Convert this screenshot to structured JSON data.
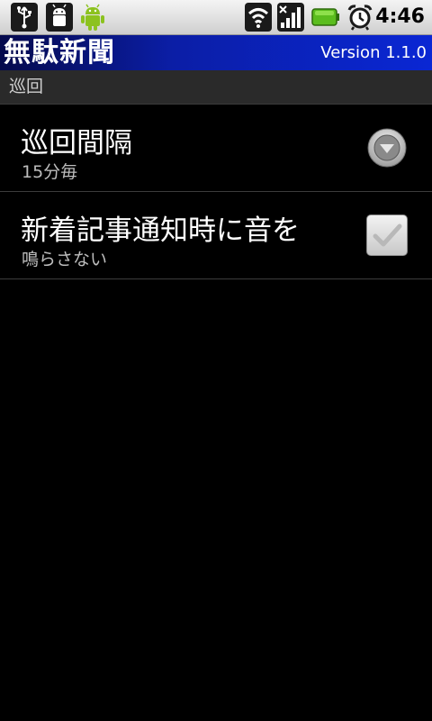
{
  "status_bar": {
    "icons": [
      "usb-icon",
      "debug-icon",
      "android-icon",
      "wifi-icon",
      "signal-icon",
      "battery-icon",
      "alarm-icon"
    ],
    "time": "4:46"
  },
  "title_bar": {
    "title": "無駄新聞",
    "version": "Version 1.1.0",
    "accent": "#0b1ea6"
  },
  "category": {
    "label": "巡回"
  },
  "preferences": [
    {
      "title": "巡回間隔",
      "summary": "15分毎",
      "widget": "spinner-icon"
    },
    {
      "title": "新着記事通知時に音を",
      "summary": "鳴らさない",
      "widget": "checkbox",
      "checked": false
    }
  ]
}
